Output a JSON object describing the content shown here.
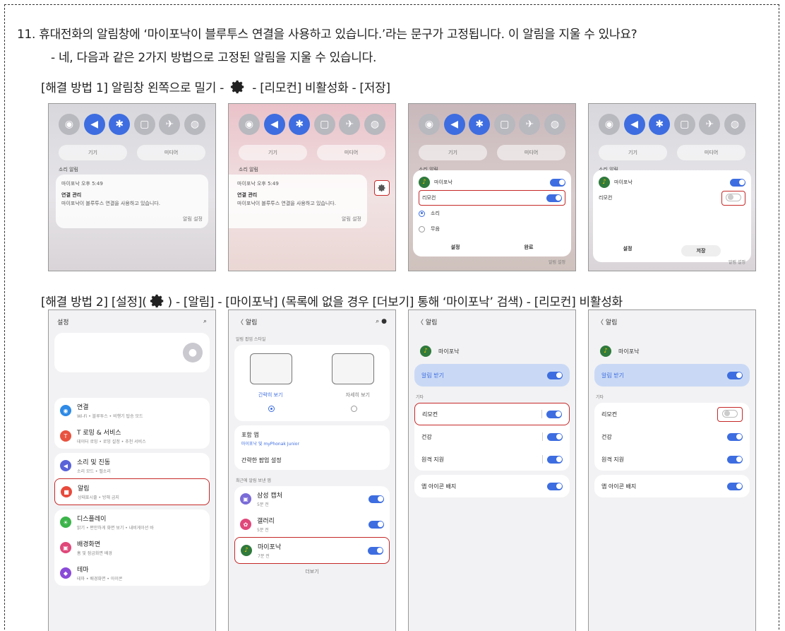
{
  "question": "11. 휴대전화의 알림창에 ‘마이포낙이 블루투스 연결을 사용하고 있습니다.’라는 문구가 고정됩니다. 이 알림을 지울 수 있나요?",
  "answer": "- 네, 다음과 같은 2가지 방법으로 고정된 알림을 지울 수 있습니다.",
  "solution1": {
    "pre": "[해결 방법 1] 알림창 왼쪽으로 밀기 -",
    "post": "- [리모컨] 비활성화 - [저장]"
  },
  "solution2": {
    "pre": "[해결 방법 2] [설정](",
    "post": ") - [알림] - [마이포낙] (목록에 없을 경우 [더보기] 통해 ‘마이포낙’ 검색) - [리모컨] 비활성화"
  },
  "panel": {
    "pill1": "기기",
    "pill2": "미디어",
    "section": "소리 알림",
    "notif_app": "마이포낙 오후 5:49",
    "notif_title": "연결 관리",
    "notif_text": "마이포낙이 블루투스 연결을 사용하고 있습니다.",
    "notif_footer": "알림 설정",
    "app_name": "마이포낙",
    "remote": "리모컨",
    "sound": "소리",
    "mute": "무음",
    "btn_settings": "설정",
    "btn_done": "완료",
    "btn_save": "저장"
  },
  "settings": {
    "title": "설정",
    "items": [
      {
        "title": "연결",
        "sub": "Wi-Fi • 블루투스 • 비행기 탑승 모드",
        "color": "#2e8ae6"
      },
      {
        "title": "T 로밍 & 서비스",
        "sub": "데이터 로밍 • 로밍 설정 • 추천 서비스",
        "color": "#e8533f"
      },
      {
        "title": "소리 및 진동",
        "sub": "소리 모드 • 벨소리",
        "color": "#5a63d8"
      },
      {
        "title": "알림",
        "sub": "상태표시줄 • 방해 금지",
        "color": "#e84a3c"
      },
      {
        "title": "디스플레이",
        "sub": "밝기 • 편안하게 화면 보기 • 내비게이션 바",
        "color": "#3cb44a"
      },
      {
        "title": "배경화면",
        "sub": "홈 및 잠금화면 배경",
        "color": "#e0487a"
      },
      {
        "title": "테마",
        "sub": "테마 • 배경화면 • 아이콘",
        "color": "#8a4ad8"
      }
    ]
  },
  "notif_screen": {
    "title": "알림",
    "style_label": "알림 팝업 스타일",
    "brief": "간략히 보기",
    "detail": "자세히 보기",
    "include": "포함 앱",
    "include_sub": "마이포낙 및 myPhonak Junior",
    "brief_settings": "간략한 팝업 설정",
    "recent": "최근에 알림 보낸 앱",
    "apps": [
      {
        "name": "삼성 캡처",
        "time": "5분 전"
      },
      {
        "name": "갤러리",
        "time": "5분 전"
      },
      {
        "name": "마이포낙",
        "time": "7분 전"
      }
    ],
    "more": "더보기"
  },
  "app_screen": {
    "back": "알림",
    "app_name": "마이포낙",
    "receive": "알림 받기",
    "other": "기타",
    "rows": [
      "리모컨",
      "건강",
      "원격 지원"
    ],
    "badge": "앱 아이콘 배지"
  },
  "colors": {
    "accent": "#3d6de0",
    "highlight": "#c62828"
  }
}
